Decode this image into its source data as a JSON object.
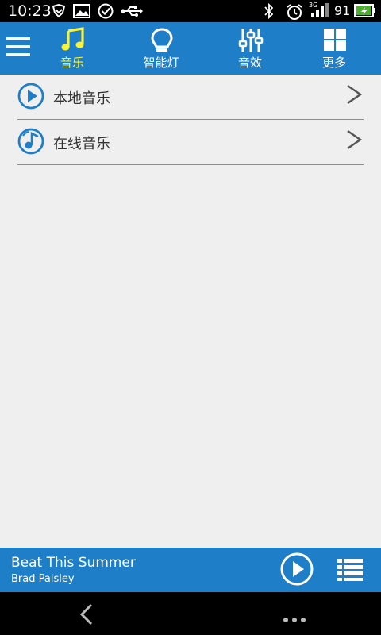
{
  "status_bar": {
    "time": "10:23",
    "network_type": "3G",
    "battery_level": "91",
    "icons": [
      "shield-check-icon",
      "image-icon",
      "checkmark-circle-icon",
      "usb-icon",
      "bluetooth-icon",
      "alarm-icon",
      "signal-icon",
      "battery-charging-icon"
    ]
  },
  "nav": {
    "tabs": [
      {
        "label": "音乐",
        "icon": "music-note-icon",
        "active": true
      },
      {
        "label": "智能灯",
        "icon": "bulb-icon",
        "active": false
      },
      {
        "label": "音效",
        "icon": "equalizer-icon",
        "active": false
      },
      {
        "label": "更多",
        "icon": "grid-icon",
        "active": false
      }
    ]
  },
  "list": {
    "items": [
      {
        "label": "本地音乐",
        "icon": "play-circle-icon"
      },
      {
        "label": "在线音乐",
        "icon": "disc-music-icon"
      }
    ]
  },
  "player": {
    "title": "Beat This Summer",
    "artist": "Brad Paisley"
  },
  "colors": {
    "primary": "#1f7ec8",
    "active_tab": "#f7f33a",
    "background": "#efefef"
  }
}
